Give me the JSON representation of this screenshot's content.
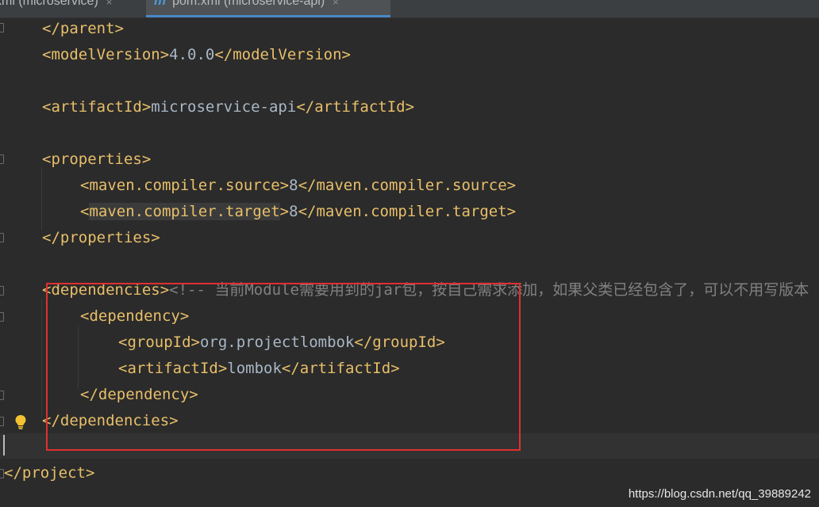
{
  "tabs": [
    {
      "label": "xml (microservice)",
      "close": "×"
    },
    {
      "label": "pom.xml (microservice-api)",
      "icon": "maven-icon",
      "close": "×",
      "active": true
    }
  ],
  "colors": {
    "background": "#2b2b2b",
    "tag": "#e8bf6a",
    "text": "#a9b7c6",
    "comment": "#808080",
    "highlight_box": "#e03030",
    "tab_accent": "#4a88c7"
  },
  "code": {
    "l1": {
      "open": "</parent>"
    },
    "l2": {
      "open": "<modelVersion>",
      "text": "4.0.0",
      "close": "</modelVersion>"
    },
    "l4": {
      "open": "<artifactId>",
      "text": "microservice-api",
      "close": "</artifactId>"
    },
    "l6": {
      "open": "<properties>"
    },
    "l7": {
      "open": "<",
      "name": "maven.compiler.source",
      "gt": ">",
      "text": "8",
      "close": "</maven.compiler.source>"
    },
    "l8": {
      "open": "<",
      "name": "maven.compiler.target",
      "gt": ">",
      "text": "8",
      "close": "</maven.compiler.target>"
    },
    "l9": {
      "open": "</properties>"
    },
    "l11": {
      "open": "<dependencies>",
      "comment": "<!-- 当前Module需要用到的jar包，按自己需求添加，如果父类已经包含了，可以不用写版本"
    },
    "l12": {
      "open": "<dependency>"
    },
    "l13": {
      "open": "<groupId>",
      "text": "org.projectlombok",
      "close": "</groupId>"
    },
    "l14": {
      "open": "<artifactId>",
      "text": "lombok",
      "close": "</artifactId>"
    },
    "l15": {
      "open": "</dependency>"
    },
    "l16": {
      "open": "</dependencies>"
    },
    "l18": {
      "open": "</project>"
    }
  },
  "watermark": "https://blog.csdn.net/qq_39889242"
}
